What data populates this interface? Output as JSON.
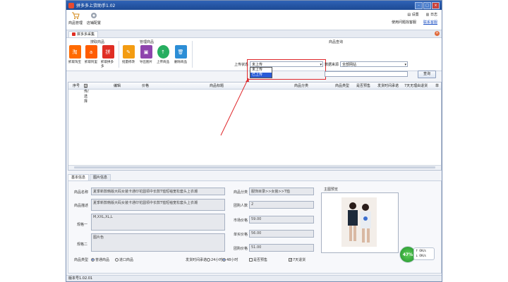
{
  "window": {
    "title": "拼多多上货助手1.02"
  },
  "toolbar": {
    "items": [
      {
        "label": "商品管理",
        "icon": "cart-icon"
      },
      {
        "label": "店铺配置",
        "icon": "gear-icon"
      }
    ],
    "settings_label": "设置",
    "log_label": "日志",
    "help_text": "使用问题找客服",
    "qq_label": "联系客服"
  },
  "tab": {
    "label": "拼多多采集"
  },
  "ribbon": {
    "group_collect": "搜取商品",
    "group_manage": "管理商品",
    "group_search": "商品查询",
    "buttons": [
      {
        "label": "抓取淘宝",
        "icon": "taobao-icon",
        "color": "#ff6a00",
        "glyph": "淘"
      },
      {
        "label": "抓取阿里",
        "icon": "ali-icon",
        "color": "#ff5c00",
        "glyph": "a"
      },
      {
        "label": "抓取拼多多",
        "icon": "pdd-icon",
        "color": "#e02e24",
        "glyph": "拼"
      },
      {
        "label": "批量修改",
        "icon": "edit-icon",
        "color": "#f39c12",
        "glyph": "✎"
      },
      {
        "label": "导出图片",
        "icon": "export-image-icon",
        "color": "#8e44ad",
        "glyph": "▣"
      },
      {
        "label": "上传商品",
        "icon": "upload-icon",
        "color": "#27ae60",
        "glyph": "↑"
      },
      {
        "label": "删除商品",
        "icon": "delete-icon",
        "color": "#2c8ed6",
        "glyph": "🗑"
      }
    ],
    "upload_status_label": "上传状态",
    "upload_status_value": "未上传",
    "upload_status_options": [
      "未上传",
      "已上传"
    ],
    "source_label": "数据来源",
    "source_value": "全部网站",
    "search_button": "查询"
  },
  "table": {
    "columns": [
      "序号",
      "上传/选择",
      "编辑",
      "价格",
      "商品标题",
      "商品分类",
      "商品类型",
      "是否预售",
      "发货时间承诺",
      "7天无理由退货",
      "单"
    ]
  },
  "bottom_tabs": [
    "基本信息",
    "图片信息"
  ],
  "detail": {
    "name_label": "商品名称",
    "name_value": "夏季新款韩版大码女装卡通印花圆领中长款T恤短袖宽松套头上衣潮",
    "desc_label": "商品描述",
    "desc_value": "夏季新款韩版大码女装卡通印花圆领中长款T恤短袖宽松套头上衣潮",
    "spec1_label": "规格一",
    "spec1_value": "M,XXL,XL,L",
    "spec2_label": "规格二",
    "spec2_value": "图片色",
    "category_label": "商品分类",
    "category_value": "服饰目录>>女装>>T恤",
    "group_label": "团购人数",
    "group_value": "2",
    "market_price_label": "市场价格",
    "market_price_value": "59.00",
    "single_price_label": "单买价格",
    "single_price_value": "56.00",
    "group_price_label": "团购价格",
    "group_price_value": "51.00",
    "main_image_label": "主图预览",
    "type_label": "商品类型",
    "type_normal": "普通商品",
    "type_import": "进口商品",
    "ship_label": "发货时间承诺",
    "ship_24": "24小时",
    "ship_48": "48小时",
    "presale_label": "是否预售",
    "refund_label": "7天退货"
  },
  "status": {
    "version": "版本号1.02.01",
    "gauge": "47%",
    "net_up": "↑ 0K/s",
    "net_down": "↓ 0K/s"
  },
  "colors": {
    "title_bar": "#1d4a94",
    "highlight": "#e0262a",
    "selection": "#2a5bd7"
  }
}
